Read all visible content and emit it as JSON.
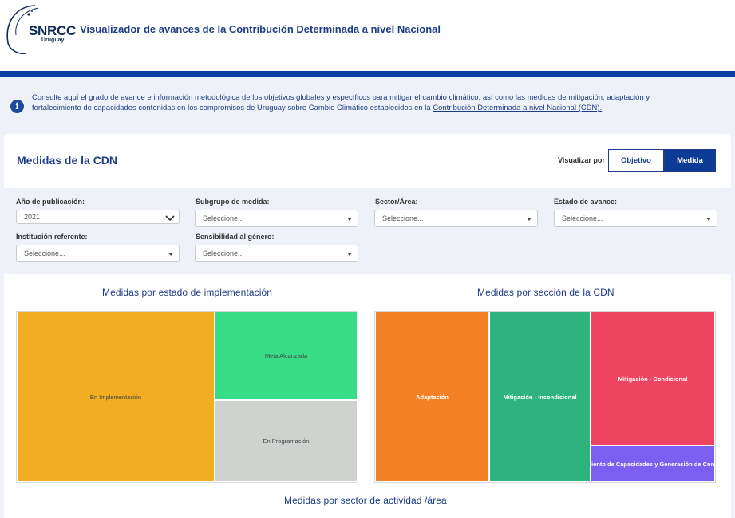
{
  "header": {
    "logo_text": "SNRCC",
    "logo_sub": "Uruguay",
    "title": "Visualizador de avances de la Contribución Determinada a nivel Nacional"
  },
  "info": {
    "icon": "info-icon",
    "text_line1": "Consulte aquí el grado de avance e información metodológica de los objetivos globales y específicos para mitigar el cambio climático, así como las medidas de mitigación, adaptación y",
    "text_line2": "fortalecimiento de capacidades contenidas en los compromisos de Uruguay sobre Cambio Climático establecidos en la ",
    "link": "Contribución Determinada a nivel Nacional (CDN)."
  },
  "card": {
    "title": "Medidas de la CDN",
    "view_label": "Visualizar por",
    "view_options": [
      "Objetivo",
      "Medida"
    ],
    "view_selected": "Medida"
  },
  "filters": {
    "year": {
      "label": "Año de publicación:",
      "value": "2021"
    },
    "subgroup": {
      "label": "Subgrupo de medida:",
      "placeholder": "Seleccione..."
    },
    "sector": {
      "label": "Sector/Área:",
      "placeholder": "Seleccione..."
    },
    "status": {
      "label": "Estado de avance:",
      "placeholder": "Seleccione..."
    },
    "institution": {
      "label": "Institución referente:",
      "placeholder": "Seleccione..."
    },
    "gender": {
      "label": "Sensibilidad al género:",
      "placeholder": "Seleccione..."
    }
  },
  "charts": {
    "status_title": "Medidas por estado de implementación",
    "section_title": "Medidas por sección de la CDN",
    "sector_title": "Medidas por sector de actividad /área"
  },
  "chart_data": [
    {
      "type": "treemap",
      "title": "Medidas por estado de implementación",
      "labels": [
        "En Implementación",
        "Meta Alcanzada",
        "En Programación"
      ],
      "values": [
        54,
        24,
        22
      ],
      "colors": [
        "#f2ad22",
        "#37dc86",
        "#cfd3d0"
      ]
    },
    {
      "type": "treemap",
      "title": "Medidas por sección de la CDN",
      "labels": [
        "Adaptación",
        "Mitigación - Incondicional",
        "Mitigación - Condicional",
        "Fortalecimiento de Capacidades y Generación de Conocimiento"
      ],
      "labels_visible": [
        "Adaptación",
        "Mitigación - Incondicional",
        "Mitigación - Condicional",
        "iento de Capacidades y Generación de Con"
      ],
      "values": [
        32,
        30,
        30,
        8
      ],
      "colors": [
        "#f48024",
        "#2eb37e",
        "#ef4461",
        "#7b5ff0"
      ]
    }
  ]
}
